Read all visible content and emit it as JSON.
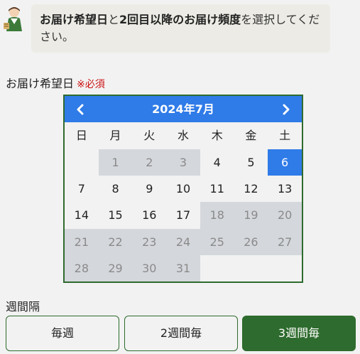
{
  "instruction": {
    "bold1": "お届け希望日",
    "text1": "と",
    "bold2": "2回目以降のお届け頻度",
    "text2": "を選択してください。"
  },
  "delivery_date": {
    "label": "お届け希望日",
    "required": "※必須"
  },
  "calendar": {
    "title": "2024年7月",
    "prev_icon": "chevron-left-icon",
    "next_icon": "chevron-right-icon",
    "weekdays": [
      "日",
      "月",
      "火",
      "水",
      "木",
      "金",
      "土"
    ],
    "leading_blank_days": 1,
    "days": [
      {
        "day": "1",
        "state": "disabled"
      },
      {
        "day": "2",
        "state": "disabled"
      },
      {
        "day": "3",
        "state": "disabled"
      },
      {
        "day": "4",
        "state": "available"
      },
      {
        "day": "5",
        "state": "available"
      },
      {
        "day": "6",
        "state": "selected"
      },
      {
        "day": "7",
        "state": "available"
      },
      {
        "day": "8",
        "state": "available"
      },
      {
        "day": "9",
        "state": "available"
      },
      {
        "day": "10",
        "state": "available"
      },
      {
        "day": "11",
        "state": "available"
      },
      {
        "day": "12",
        "state": "available"
      },
      {
        "day": "13",
        "state": "available"
      },
      {
        "day": "14",
        "state": "available"
      },
      {
        "day": "15",
        "state": "available"
      },
      {
        "day": "16",
        "state": "available"
      },
      {
        "day": "17",
        "state": "available"
      },
      {
        "day": "18",
        "state": "disabled"
      },
      {
        "day": "19",
        "state": "disabled"
      },
      {
        "day": "20",
        "state": "disabled"
      },
      {
        "day": "21",
        "state": "disabled"
      },
      {
        "day": "22",
        "state": "disabled"
      },
      {
        "day": "23",
        "state": "disabled"
      },
      {
        "day": "24",
        "state": "disabled"
      },
      {
        "day": "25",
        "state": "disabled"
      },
      {
        "day": "26",
        "state": "disabled"
      },
      {
        "day": "27",
        "state": "disabled"
      },
      {
        "day": "28",
        "state": "disabled"
      },
      {
        "day": "29",
        "state": "disabled"
      },
      {
        "day": "30",
        "state": "disabled"
      },
      {
        "day": "31",
        "state": "disabled"
      }
    ]
  },
  "interval": {
    "label": "週間隔",
    "options": [
      {
        "label": "毎週",
        "active": false
      },
      {
        "label": "2週間毎",
        "active": false
      },
      {
        "label": "3週間毎",
        "active": true
      }
    ]
  },
  "colors": {
    "accent_blue": "#2f7be8",
    "accent_green": "#2e6b2e",
    "disabled_gray": "#d4d7dc",
    "required_red": "#cc1111"
  }
}
